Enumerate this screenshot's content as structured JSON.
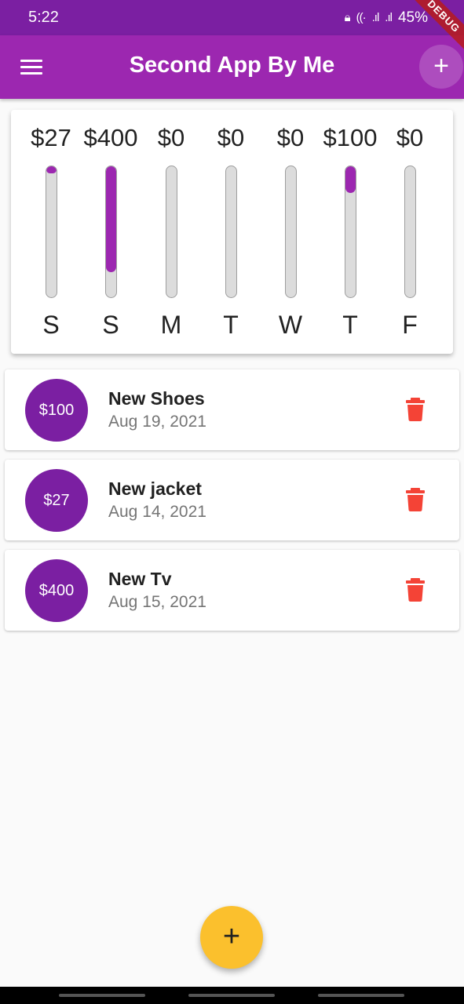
{
  "status_bar": {
    "time": "5:22",
    "battery": "45%",
    "icons": [
      "lock-icon",
      "wifi-icon",
      "signal-icon",
      "signal-icon"
    ]
  },
  "debug_banner": "DEBUG",
  "app_bar": {
    "title": "Second App By Me",
    "menu_icon": "hamburger-menu-icon",
    "add_icon": "plus-icon",
    "add_label": "+",
    "color": "#9c27b0"
  },
  "chart": {
    "bars": [
      {
        "day": "S",
        "amount": "$27",
        "fraction": 0.0545
      },
      {
        "day": "S",
        "amount": "$400",
        "fraction": 0.8081
      },
      {
        "day": "M",
        "amount": "$0",
        "fraction": 0
      },
      {
        "day": "T",
        "amount": "$0",
        "fraction": 0
      },
      {
        "day": "W",
        "amount": "$0",
        "fraction": 0
      },
      {
        "day": "T",
        "amount": "$100",
        "fraction": 0.202
      },
      {
        "day": "F",
        "amount": "$0",
        "fraction": 0
      }
    ],
    "fill_color": "#9c27b0"
  },
  "transactions": [
    {
      "amount": "$100",
      "title": "New Shoes",
      "date": "Aug 19, 2021"
    },
    {
      "amount": "$27",
      "title": "New jacket",
      "date": "Aug 14, 2021"
    },
    {
      "amount": "$400",
      "title": "New Tv",
      "date": "Aug 15, 2021"
    }
  ],
  "delete_icon": "trash-icon",
  "delete_color": "#f44336",
  "fab": {
    "label": "+",
    "icon": "plus-icon",
    "color": "#fbc02d"
  }
}
